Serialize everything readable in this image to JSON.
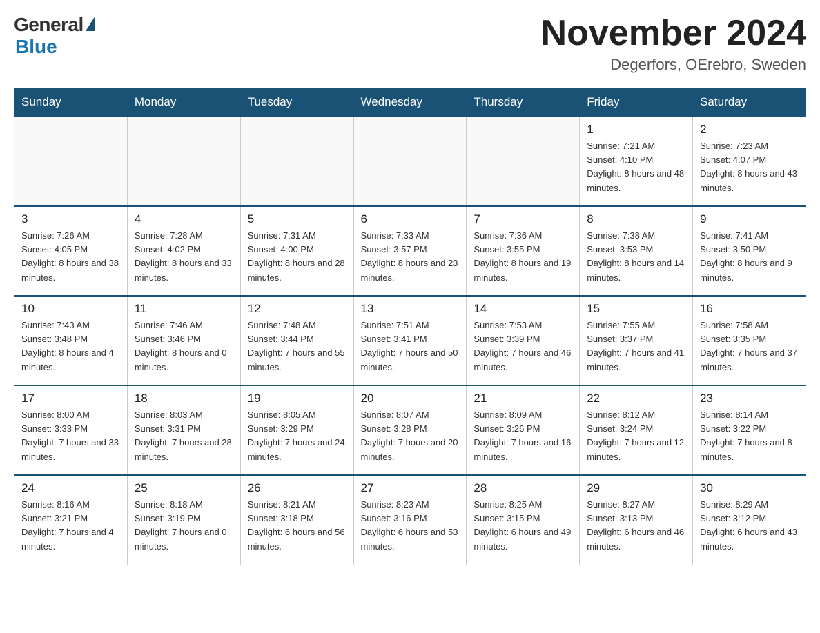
{
  "header": {
    "logo_general": "General",
    "logo_blue": "Blue",
    "month_title": "November 2024",
    "location": "Degerfors, OErebro, Sweden"
  },
  "weekdays": [
    "Sunday",
    "Monday",
    "Tuesday",
    "Wednesday",
    "Thursday",
    "Friday",
    "Saturday"
  ],
  "weeks": [
    [
      {
        "day": "",
        "sunrise": "",
        "sunset": "",
        "daylight": ""
      },
      {
        "day": "",
        "sunrise": "",
        "sunset": "",
        "daylight": ""
      },
      {
        "day": "",
        "sunrise": "",
        "sunset": "",
        "daylight": ""
      },
      {
        "day": "",
        "sunrise": "",
        "sunset": "",
        "daylight": ""
      },
      {
        "day": "",
        "sunrise": "",
        "sunset": "",
        "daylight": ""
      },
      {
        "day": "1",
        "sunrise": "Sunrise: 7:21 AM",
        "sunset": "Sunset: 4:10 PM",
        "daylight": "Daylight: 8 hours and 48 minutes."
      },
      {
        "day": "2",
        "sunrise": "Sunrise: 7:23 AM",
        "sunset": "Sunset: 4:07 PM",
        "daylight": "Daylight: 8 hours and 43 minutes."
      }
    ],
    [
      {
        "day": "3",
        "sunrise": "Sunrise: 7:26 AM",
        "sunset": "Sunset: 4:05 PM",
        "daylight": "Daylight: 8 hours and 38 minutes."
      },
      {
        "day": "4",
        "sunrise": "Sunrise: 7:28 AM",
        "sunset": "Sunset: 4:02 PM",
        "daylight": "Daylight: 8 hours and 33 minutes."
      },
      {
        "day": "5",
        "sunrise": "Sunrise: 7:31 AM",
        "sunset": "Sunset: 4:00 PM",
        "daylight": "Daylight: 8 hours and 28 minutes."
      },
      {
        "day": "6",
        "sunrise": "Sunrise: 7:33 AM",
        "sunset": "Sunset: 3:57 PM",
        "daylight": "Daylight: 8 hours and 23 minutes."
      },
      {
        "day": "7",
        "sunrise": "Sunrise: 7:36 AM",
        "sunset": "Sunset: 3:55 PM",
        "daylight": "Daylight: 8 hours and 19 minutes."
      },
      {
        "day": "8",
        "sunrise": "Sunrise: 7:38 AM",
        "sunset": "Sunset: 3:53 PM",
        "daylight": "Daylight: 8 hours and 14 minutes."
      },
      {
        "day": "9",
        "sunrise": "Sunrise: 7:41 AM",
        "sunset": "Sunset: 3:50 PM",
        "daylight": "Daylight: 8 hours and 9 minutes."
      }
    ],
    [
      {
        "day": "10",
        "sunrise": "Sunrise: 7:43 AM",
        "sunset": "Sunset: 3:48 PM",
        "daylight": "Daylight: 8 hours and 4 minutes."
      },
      {
        "day": "11",
        "sunrise": "Sunrise: 7:46 AM",
        "sunset": "Sunset: 3:46 PM",
        "daylight": "Daylight: 8 hours and 0 minutes."
      },
      {
        "day": "12",
        "sunrise": "Sunrise: 7:48 AM",
        "sunset": "Sunset: 3:44 PM",
        "daylight": "Daylight: 7 hours and 55 minutes."
      },
      {
        "day": "13",
        "sunrise": "Sunrise: 7:51 AM",
        "sunset": "Sunset: 3:41 PM",
        "daylight": "Daylight: 7 hours and 50 minutes."
      },
      {
        "day": "14",
        "sunrise": "Sunrise: 7:53 AM",
        "sunset": "Sunset: 3:39 PM",
        "daylight": "Daylight: 7 hours and 46 minutes."
      },
      {
        "day": "15",
        "sunrise": "Sunrise: 7:55 AM",
        "sunset": "Sunset: 3:37 PM",
        "daylight": "Daylight: 7 hours and 41 minutes."
      },
      {
        "day": "16",
        "sunrise": "Sunrise: 7:58 AM",
        "sunset": "Sunset: 3:35 PM",
        "daylight": "Daylight: 7 hours and 37 minutes."
      }
    ],
    [
      {
        "day": "17",
        "sunrise": "Sunrise: 8:00 AM",
        "sunset": "Sunset: 3:33 PM",
        "daylight": "Daylight: 7 hours and 33 minutes."
      },
      {
        "day": "18",
        "sunrise": "Sunrise: 8:03 AM",
        "sunset": "Sunset: 3:31 PM",
        "daylight": "Daylight: 7 hours and 28 minutes."
      },
      {
        "day": "19",
        "sunrise": "Sunrise: 8:05 AM",
        "sunset": "Sunset: 3:29 PM",
        "daylight": "Daylight: 7 hours and 24 minutes."
      },
      {
        "day": "20",
        "sunrise": "Sunrise: 8:07 AM",
        "sunset": "Sunset: 3:28 PM",
        "daylight": "Daylight: 7 hours and 20 minutes."
      },
      {
        "day": "21",
        "sunrise": "Sunrise: 8:09 AM",
        "sunset": "Sunset: 3:26 PM",
        "daylight": "Daylight: 7 hours and 16 minutes."
      },
      {
        "day": "22",
        "sunrise": "Sunrise: 8:12 AM",
        "sunset": "Sunset: 3:24 PM",
        "daylight": "Daylight: 7 hours and 12 minutes."
      },
      {
        "day": "23",
        "sunrise": "Sunrise: 8:14 AM",
        "sunset": "Sunset: 3:22 PM",
        "daylight": "Daylight: 7 hours and 8 minutes."
      }
    ],
    [
      {
        "day": "24",
        "sunrise": "Sunrise: 8:16 AM",
        "sunset": "Sunset: 3:21 PM",
        "daylight": "Daylight: 7 hours and 4 minutes."
      },
      {
        "day": "25",
        "sunrise": "Sunrise: 8:18 AM",
        "sunset": "Sunset: 3:19 PM",
        "daylight": "Daylight: 7 hours and 0 minutes."
      },
      {
        "day": "26",
        "sunrise": "Sunrise: 8:21 AM",
        "sunset": "Sunset: 3:18 PM",
        "daylight": "Daylight: 6 hours and 56 minutes."
      },
      {
        "day": "27",
        "sunrise": "Sunrise: 8:23 AM",
        "sunset": "Sunset: 3:16 PM",
        "daylight": "Daylight: 6 hours and 53 minutes."
      },
      {
        "day": "28",
        "sunrise": "Sunrise: 8:25 AM",
        "sunset": "Sunset: 3:15 PM",
        "daylight": "Daylight: 6 hours and 49 minutes."
      },
      {
        "day": "29",
        "sunrise": "Sunrise: 8:27 AM",
        "sunset": "Sunset: 3:13 PM",
        "daylight": "Daylight: 6 hours and 46 minutes."
      },
      {
        "day": "30",
        "sunrise": "Sunrise: 8:29 AM",
        "sunset": "Sunset: 3:12 PM",
        "daylight": "Daylight: 6 hours and 43 minutes."
      }
    ]
  ]
}
